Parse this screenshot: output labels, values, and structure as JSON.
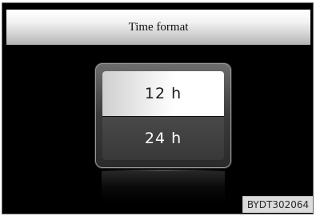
{
  "header": {
    "title": "Time format"
  },
  "options": [
    {
      "label": "12 h",
      "selected": true
    },
    {
      "label": "24 h",
      "selected": false
    }
  ],
  "watermark": "BYDT302064",
  "colors": {
    "background": "#000000",
    "header": "#e0e0e0",
    "selected_option": "#ffffff",
    "unselected_option": "#404040"
  }
}
